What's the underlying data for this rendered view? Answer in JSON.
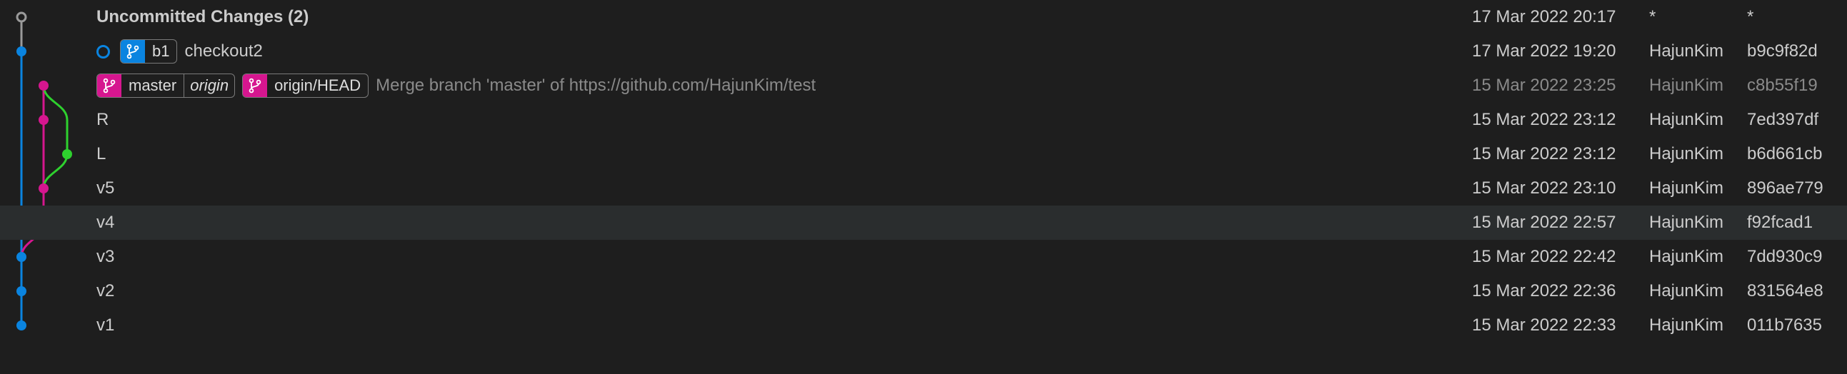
{
  "colors": {
    "background": "#1e1e1e",
    "row_hover": "#2a2d2e",
    "graph_blue": "#0a84e0",
    "graph_magenta": "#d6168f",
    "graph_green": "#2ed12e",
    "graph_gray": "#9a9a9a",
    "faded_text": "#8a8a8a"
  },
  "commits": [
    {
      "message": "Uncommitted Changes (2)",
      "date": "17 Mar 2022 20:17",
      "author": "*",
      "hash": "*",
      "bold": true
    },
    {
      "message": "checkout2",
      "date": "17 Mar 2022 19:20",
      "author": "HajunKim",
      "hash": "b9c9f82d",
      "refs": [
        {
          "name": "b1",
          "color": "#0a84e0",
          "icon": "branch-icon"
        }
      ],
      "head_marker": "ring-icon"
    },
    {
      "message": "Merge branch 'master' of https://github.com/HajunKim/test",
      "date": "15 Mar 2022 23:25",
      "author": "HajunKim",
      "hash": "c8b55f19",
      "faded": true,
      "refs": [
        {
          "name": "master",
          "remote": "origin",
          "color": "#d6168f",
          "icon": "branch-icon"
        },
        {
          "name": "origin/HEAD",
          "color": "#d6168f",
          "icon": "branch-icon"
        }
      ]
    },
    {
      "message": "R",
      "date": "15 Mar 2022 23:12",
      "author": "HajunKim",
      "hash": "7ed397df"
    },
    {
      "message": "L",
      "date": "15 Mar 2022 23:12",
      "author": "HajunKim",
      "hash": "b6d661cb"
    },
    {
      "message": "v5",
      "date": "15 Mar 2022 23:10",
      "author": "HajunKim",
      "hash": "896ae779"
    },
    {
      "message": "v4",
      "date": "15 Mar 2022 22:57",
      "author": "HajunKim",
      "hash": "f92fcad1",
      "hover": true
    },
    {
      "message": "v3",
      "date": "15 Mar 2022 22:42",
      "author": "HajunKim",
      "hash": "7dd930c9"
    },
    {
      "message": "v2",
      "date": "15 Mar 2022 22:36",
      "author": "HajunKim",
      "hash": "831564e8"
    },
    {
      "message": "v1",
      "date": "15 Mar 2022 22:33",
      "author": "HajunKim",
      "hash": "011b7635"
    }
  ]
}
